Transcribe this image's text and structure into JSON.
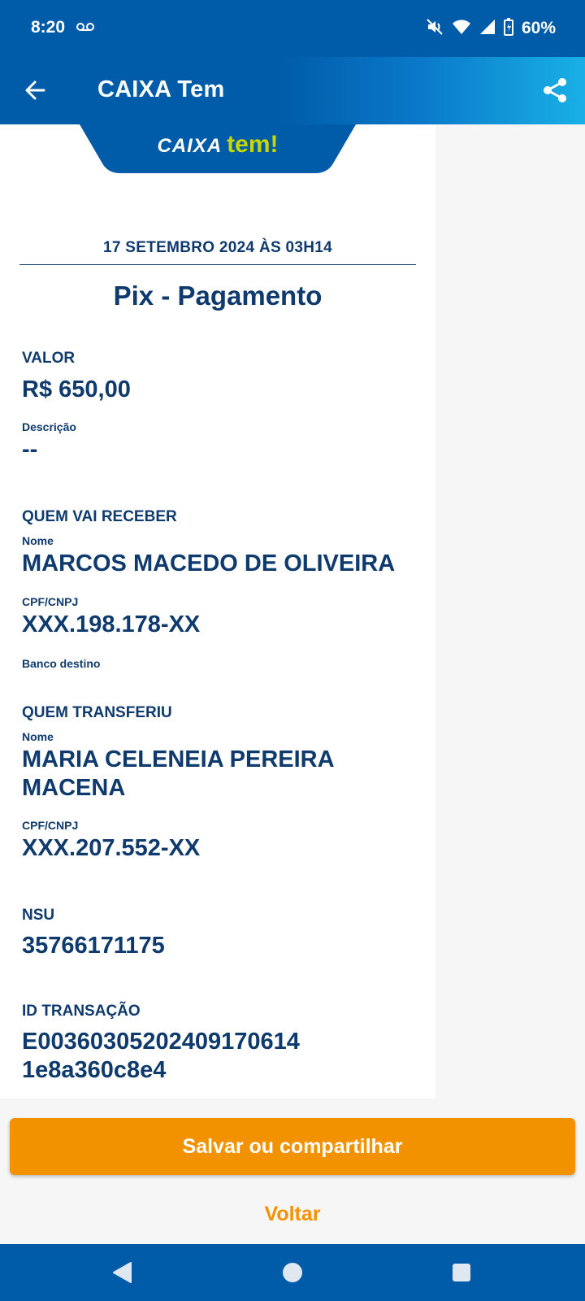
{
  "status_bar": {
    "time": "8:20",
    "battery": "60%",
    "icons": [
      "voicemail-icon",
      "mute-icon",
      "wifi-icon",
      "signal-icon",
      "battery-icon"
    ]
  },
  "app_bar": {
    "title": "CAIXA Tem",
    "back_icon": "arrow-left-icon",
    "share_icon": "share-icon"
  },
  "logo": {
    "caixa": "CAIXA",
    "tem": "tem!"
  },
  "receipt": {
    "date": "17 SETEMBRO 2024 ÀS 03H14",
    "title": "Pix - Pagamento",
    "valor_label": "VALOR",
    "valor": "R$ 650,00",
    "descricao_label": "Descrição",
    "descricao": "--",
    "receiver": {
      "section_label": "QUEM VAI RECEBER",
      "name_label": "Nome",
      "name": "MARCOS MACEDO DE OLIVEIRA",
      "doc_label": "CPF/CNPJ",
      "doc": "XXX.198.178-XX",
      "bank_label": "Banco destino"
    },
    "sender": {
      "section_label": "QUEM TRANSFERIU",
      "name_label": "Nome",
      "name": "MARIA CELENEIA PEREIRA MACENA",
      "doc_label": "CPF/CNPJ",
      "doc": "XXX.207.552-XX"
    },
    "nsu_label": "NSU",
    "nsu": "35766171175",
    "id_label": "ID TRANSAÇÃO",
    "id": "E00360305202409170614 1e8a360c8e4"
  },
  "footer": {
    "save_label": "Salvar ou compartilhar",
    "back_label": "Voltar"
  },
  "colors": {
    "primary_blue": "#005ca9",
    "text_navy": "#0e3a6d",
    "accent_orange": "#f39200",
    "logo_green": "#c7d600"
  }
}
